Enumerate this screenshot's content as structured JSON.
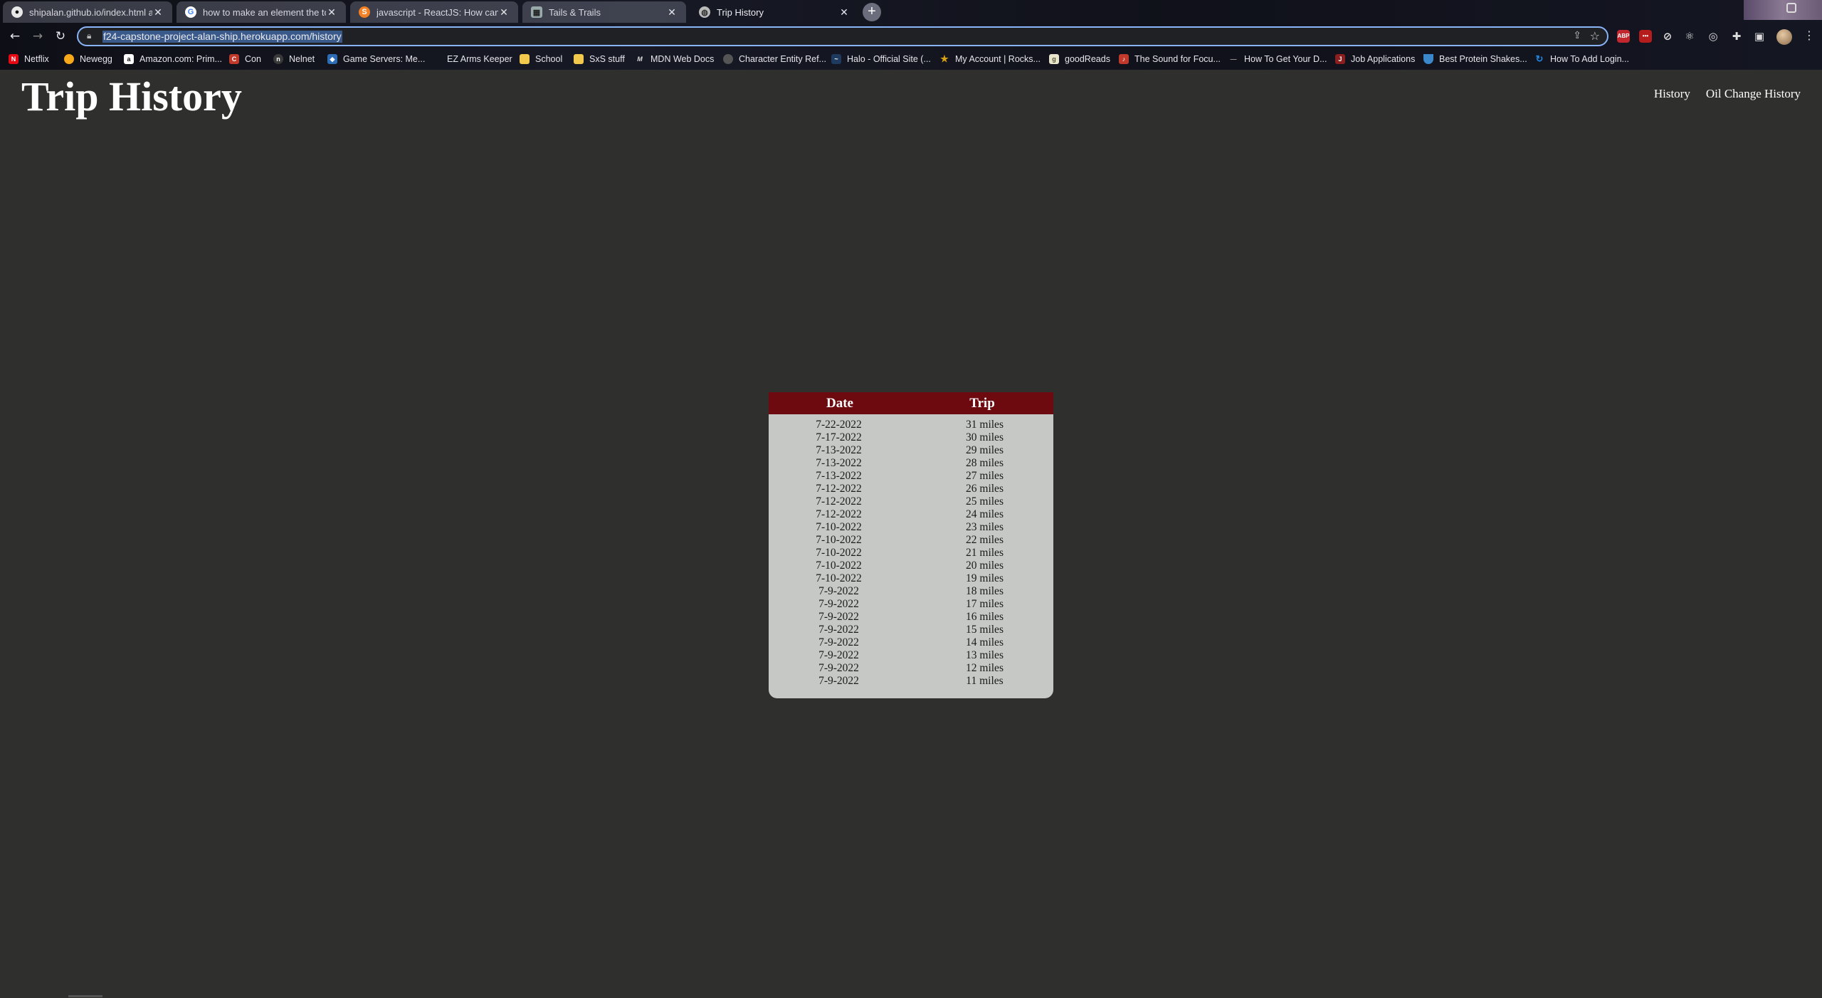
{
  "browser": {
    "tabs": [
      {
        "label": "shipalan.github.io/index.html at...",
        "icon": "github-icon",
        "active": false
      },
      {
        "label": "how to make an element the to...",
        "icon": "google-icon",
        "active": false
      },
      {
        "label": "javascript - ReactJS: How can I ti...",
        "icon": "stackoverflow-icon",
        "active": false
      },
      {
        "label": "Tails & Trails",
        "icon": "page-icon",
        "active": false
      },
      {
        "label": "Trip History",
        "icon": "globe-icon",
        "active": true
      }
    ],
    "new_tab_label": "+",
    "url": "f24-capstone-project-alan-ship.herokuapp.com/history",
    "bookmarks": [
      {
        "label": "Netflix",
        "icon": "netflix-icon",
        "color": "#e50914"
      },
      {
        "label": "Newegg",
        "icon": "newegg-icon",
        "color": "#f7a81b"
      },
      {
        "label": "Amazon.com: Prim...",
        "icon": "amazon-icon",
        "color": "#222222"
      },
      {
        "label": "Con",
        "icon": "con-icon",
        "color": "#c0392b"
      },
      {
        "label": "Nelnet",
        "icon": "nelnet-icon",
        "color": "#3a3a3a"
      },
      {
        "label": "Game Servers: Me...",
        "icon": "server-icon",
        "color": "#2d6db5"
      },
      {
        "label": "EZ Arms Keeper",
        "icon": "page-icon",
        "color": "#444444"
      },
      {
        "label": "School",
        "icon": "folder-icon",
        "color": "#f2c94c"
      },
      {
        "label": "SxS stuff",
        "icon": "folder-icon",
        "color": "#f2c94c"
      },
      {
        "label": "MDN Web Docs",
        "icon": "mdn-icon",
        "color": "#222222"
      },
      {
        "label": "Character Entity Ref...",
        "icon": "globe-icon",
        "color": "#555555"
      },
      {
        "label": "Halo - Official Site (...",
        "icon": "halo-icon",
        "color": "#1e3a5f"
      },
      {
        "label": "My Account | Rocks...",
        "icon": "star-icon",
        "color": "#d4a017"
      },
      {
        "label": "goodReads",
        "icon": "goodreads-icon",
        "color": "#e9e5cd"
      },
      {
        "label": "The Sound for Focu...",
        "icon": "sound-icon",
        "color": "#c0392b"
      },
      {
        "label": "How To Get Your D...",
        "icon": "page-icon",
        "color": "#555555"
      },
      {
        "label": "Job Applications",
        "icon": "job-icon",
        "color": "#8b1e1e"
      },
      {
        "label": "Best Protein Shakes...",
        "icon": "bowl-icon",
        "color": "#3a88c9"
      },
      {
        "label": "How To Add Login...",
        "icon": "refresh-icon",
        "color": "#1e88e5"
      }
    ]
  },
  "page": {
    "title": "Trip History",
    "nav": [
      "History",
      "Oil Change History"
    ]
  },
  "table": {
    "headers": [
      "Date",
      "Trip"
    ],
    "rows": [
      [
        "7-22-2022",
        "31 miles"
      ],
      [
        "7-17-2022",
        "30 miles"
      ],
      [
        "7-13-2022",
        "29 miles"
      ],
      [
        "7-13-2022",
        "28 miles"
      ],
      [
        "7-13-2022",
        "27 miles"
      ],
      [
        "7-12-2022",
        "26 miles"
      ],
      [
        "7-12-2022",
        "25 miles"
      ],
      [
        "7-12-2022",
        "24 miles"
      ],
      [
        "7-10-2022",
        "23 miles"
      ],
      [
        "7-10-2022",
        "22 miles"
      ],
      [
        "7-10-2022",
        "21 miles"
      ],
      [
        "7-10-2022",
        "20 miles"
      ],
      [
        "7-10-2022",
        "19 miles"
      ],
      [
        "7-9-2022",
        "18 miles"
      ],
      [
        "7-9-2022",
        "17 miles"
      ],
      [
        "7-9-2022",
        "16 miles"
      ],
      [
        "7-9-2022",
        "15 miles"
      ],
      [
        "7-9-2022",
        "14 miles"
      ],
      [
        "7-9-2022",
        "13 miles"
      ],
      [
        "7-9-2022",
        "12 miles"
      ],
      [
        "7-9-2022",
        "11 miles"
      ]
    ]
  },
  "colors": {
    "page_background": "#2f2f2d",
    "table_header": "#6c0a10",
    "table_body": "#c5c8c4"
  }
}
